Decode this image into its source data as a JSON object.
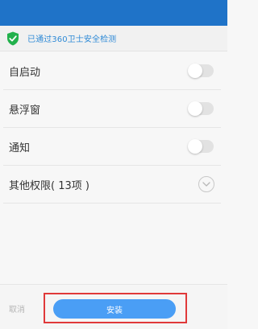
{
  "security": {
    "text": "已通过360卫士安全检测",
    "icon": "shield-check-icon",
    "color": "#2f8ad6"
  },
  "permissions": [
    {
      "label": "自启动",
      "control": "toggle",
      "enabled": false
    },
    {
      "label": "悬浮窗",
      "control": "toggle",
      "enabled": false
    },
    {
      "label": "通知",
      "control": "toggle",
      "enabled": false
    },
    {
      "label": "其他权限( 13项 )",
      "control": "expand",
      "icon": "chevron-down-circle-icon"
    }
  ],
  "footer": {
    "cancel_label": "取消",
    "install_label": "安装",
    "install_color": "#4a9ef5",
    "highlight_color": "#e0393a"
  },
  "colors": {
    "topbar": "#1f73c8"
  }
}
